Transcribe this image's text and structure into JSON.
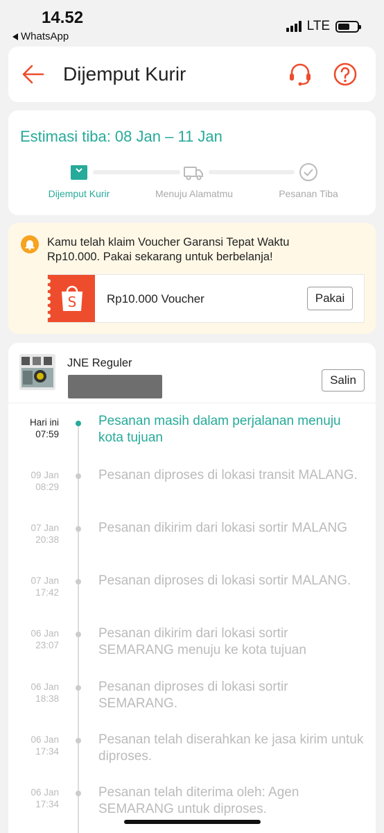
{
  "status_bar": {
    "time": "14.52",
    "back_app": "WhatsApp",
    "network": "LTE"
  },
  "header": {
    "title": "Dijemput Kurir"
  },
  "estimate": {
    "title": "Estimasi tiba: 08 Jan – 11 Jan",
    "steps": [
      {
        "label": "Dijemput Kurir",
        "state": "active"
      },
      {
        "label": "Menuju Alamatmu",
        "state": "pending"
      },
      {
        "label": "Pesanan Tiba",
        "state": "pending"
      }
    ]
  },
  "voucher": {
    "message": "Kamu telah klaim Voucher Garansi Tepat Waktu Rp10.000. Pakai sekarang untuk berbelanja!",
    "name": "Rp10.000 Voucher",
    "button": "Pakai"
  },
  "tracking": {
    "courier": "JNE Reguler",
    "copy_button": "Salin",
    "events": [
      {
        "date": "Hari ini",
        "time": "07:59",
        "text": "Pesanan masih dalam perjalanan menuju kota tujuan"
      },
      {
        "date": "09 Jan",
        "time": "08:29",
        "text": "Pesanan diproses di lokasi transit MALANG."
      },
      {
        "date": "07 Jan",
        "time": "20:38",
        "text": "Pesanan dikirim dari lokasi sortir MALANG"
      },
      {
        "date": "07 Jan",
        "time": "17:42",
        "text": "Pesanan diproses di lokasi sortir MALANG."
      },
      {
        "date": "06 Jan",
        "time": "23:07",
        "text": "Pesanan dikirim dari lokasi sortir SEMARANG menuju ke kota tujuan"
      },
      {
        "date": "06 Jan",
        "time": "18:38",
        "text": "Pesanan diproses di lokasi sortir SEMARANG."
      },
      {
        "date": "06 Jan",
        "time": "17:34",
        "text": "Pesanan telah diserahkan ke jasa kirim untuk diproses."
      },
      {
        "date": "06 Jan",
        "time": "17:34",
        "text": "Pesanan telah diterima oleh: Agen SEMARANG untuk diproses."
      }
    ]
  },
  "colors": {
    "brand": "#ee4d2d",
    "teal": "#26aa99",
    "voucher_bg": "#fff8e6"
  }
}
